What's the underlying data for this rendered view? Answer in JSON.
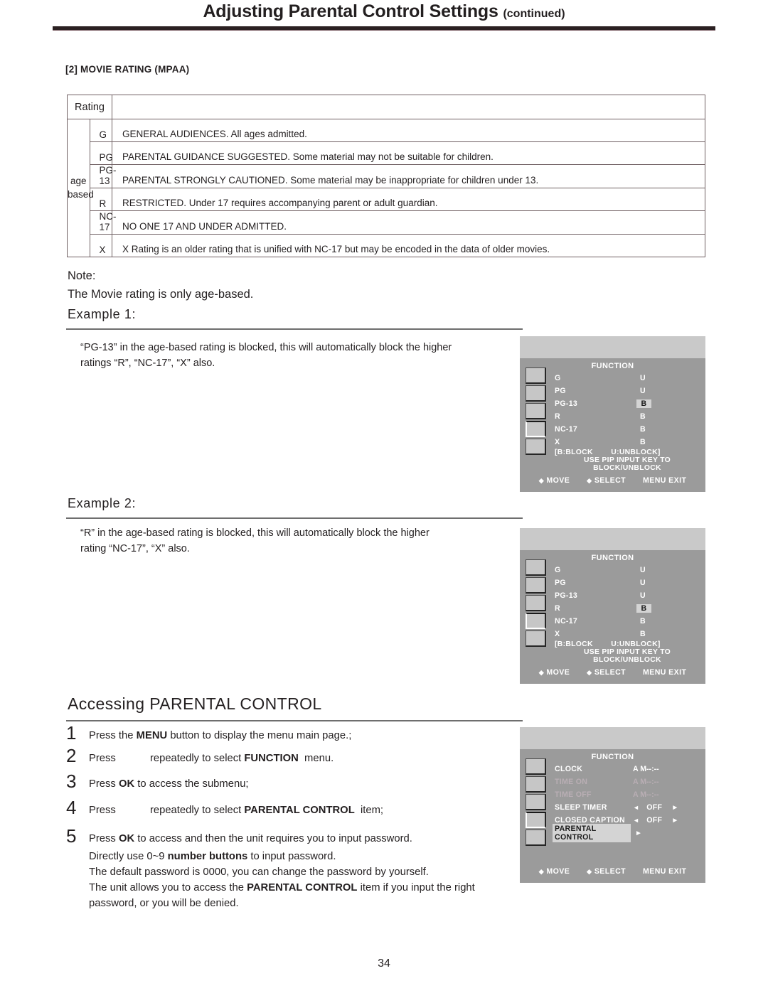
{
  "header": {
    "title": "Adjusting Parental Control Settings",
    "continued": "(continued)"
  },
  "section": {
    "tag": "[2] MOVIE RATING (MPAA)"
  },
  "rating_table": {
    "header_rating": "Rating",
    "header_blank": "",
    "group_label_line1": "age",
    "group_label_line2": "based",
    "rows": [
      {
        "code": "G",
        "desc": "GENERAL AUDIENCES. All ages admitted."
      },
      {
        "code": "PG",
        "desc": "PARENTAL GUIDANCE SUGGESTED. Some material may not be suitable for children."
      },
      {
        "code": "PG-13",
        "desc": "PARENTAL STRONGLY CAUTIONED. Some material may be inappropriate for children under 13."
      },
      {
        "code": "R",
        "desc": "RESTRICTED. Under 17 requires accompanying parent or adult guardian."
      },
      {
        "code": "NC-17",
        "desc": "NO ONE 17 AND UNDER ADMITTED."
      },
      {
        "code": "X",
        "desc": "X Rating is an older rating that is unified with NC-17 but may be encoded in the data of older movies."
      }
    ]
  },
  "note": {
    "label": "Note:",
    "text": "The Movie rating is only age-based."
  },
  "example1": {
    "heading": "Example 1:",
    "line1": "“PG-13” in the age-based rating is blocked, this will automatically block the higher",
    "line2": "ratings “R”, “NC-17”, “X” also."
  },
  "example2": {
    "heading": "Example 2:",
    "line1": "“R” in the age-based rating is blocked, this will automatically block the higher",
    "line2": "rating “NC-17”, “X” also."
  },
  "accessing": {
    "heading": "Accessing PARENTAL CONTROL",
    "steps": [
      {
        "num": "1",
        "html": "Press  the <b>MENU</b> button to display the menu main  page.;"
      },
      {
        "num": "2",
        "html": "Press <span class=\"step-gap\"></span>repeatedly to select <b>FUNCTION</b>&nbsp; menu."
      },
      {
        "num": "3",
        "html": "Press <b>OK</b> to access the submenu;"
      },
      {
        "num": "4",
        "html": "Press <span class=\"step-gap\"></span>repeatedly to select <b>PARENTAL CONTROL</b>&nbsp; item;"
      },
      {
        "num": "5",
        "html": "Press <b>OK</b> to access and then the unit requires you to input password."
      }
    ],
    "substeps": [
      "Directly use 0~9 <b>number buttons</b> to input password.",
      "The default password is 0000, you can change the password by yourself.",
      "The unit allows you to access the <b>PARENTAL CONTROL</b> item if you input the right",
      "password, or  you will be denied."
    ]
  },
  "osd_common": {
    "title": "FUNCTION",
    "legend_line1": "[B:BLOCK        U:UNBLOCK]",
    "legend_line2": "USE  PIP INPUT  KEY  TO",
    "legend_line3": "BLOCK/UNBLOCK",
    "bottom_move": "MOVE",
    "bottom_select": "SELECT",
    "bottom_menu_exit": "MENU EXIT",
    "diamond_updown": "◆",
    "diamond_leftright": "◆"
  },
  "osd1": {
    "title": "FUNCTION",
    "active_tab_index": 3,
    "rows": [
      {
        "label": "G",
        "value": "U",
        "highlight": false
      },
      {
        "label": "PG",
        "value": "U",
        "highlight": false
      },
      {
        "label": "PG-13",
        "value": "B",
        "highlight": true
      },
      {
        "label": "R",
        "value": "B",
        "highlight": false
      },
      {
        "label": "NC-17",
        "value": "B",
        "highlight": false
      },
      {
        "label": "X",
        "value": "B",
        "highlight": false
      }
    ]
  },
  "osd2": {
    "title": "FUNCTION",
    "active_tab_index": 3,
    "rows": [
      {
        "label": "G",
        "value": "U",
        "highlight": false
      },
      {
        "label": "PG",
        "value": "U",
        "highlight": false
      },
      {
        "label": "PG-13",
        "value": "U",
        "highlight": false
      },
      {
        "label": "R",
        "value": "B",
        "highlight": true
      },
      {
        "label": "NC-17",
        "value": "B",
        "highlight": false
      },
      {
        "label": "X",
        "value": "B",
        "highlight": false
      }
    ]
  },
  "osd3": {
    "title": "FUNCTION",
    "active_tab_index": 3,
    "rows": [
      {
        "label": "CLOCK",
        "value": "A M--:--",
        "disabled": false,
        "selected": false,
        "arrows": false
      },
      {
        "label": "TIME ON",
        "value": "A M--:--",
        "disabled": true,
        "selected": false,
        "arrows": false
      },
      {
        "label": "TIME OFF",
        "value": "A M--:--",
        "disabled": true,
        "selected": false,
        "arrows": false
      },
      {
        "label": "SLEEP TIMER",
        "value": "OFF",
        "disabled": false,
        "selected": false,
        "arrows": true
      },
      {
        "label": "CLOSED CAPTION",
        "value": "OFF",
        "disabled": false,
        "selected": false,
        "arrows": true
      },
      {
        "label": "PARENTAL CONTROL",
        "value": "",
        "disabled": false,
        "selected": true,
        "arrows": false
      }
    ],
    "arrow_left": "◄",
    "arrow_right": "►"
  },
  "page_number": "34"
}
